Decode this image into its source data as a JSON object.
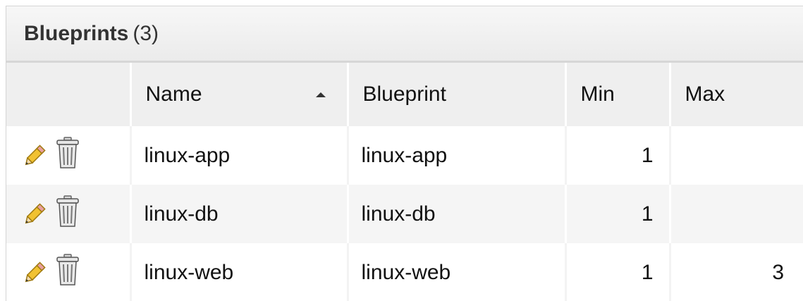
{
  "panel": {
    "title": "Blueprints",
    "count": "(3)"
  },
  "table": {
    "columns": [
      "",
      "Name",
      "Blueprint",
      "Min",
      "Max"
    ],
    "sort_column": "Name",
    "sort_direction": "ascending",
    "rows": [
      {
        "name": "linux-app",
        "blueprint": "linux-app",
        "min": "1",
        "max": ""
      },
      {
        "name": "linux-db",
        "blueprint": "linux-db",
        "min": "1",
        "max": ""
      },
      {
        "name": "linux-web",
        "blueprint": "linux-web",
        "min": "1",
        "max": "3"
      }
    ]
  },
  "icons": {
    "edit": "pencil-icon",
    "delete": "trash-icon"
  }
}
